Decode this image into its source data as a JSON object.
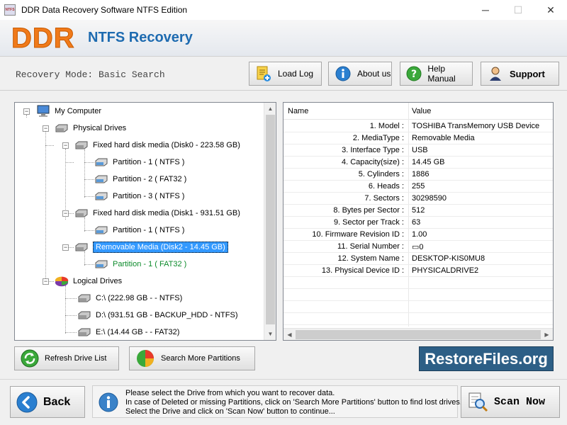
{
  "window": {
    "title": "DDR Data Recovery Software NTFS Edition",
    "minimize": "─",
    "maximize": "☐",
    "close": "✕"
  },
  "banner": {
    "logo": "DDR",
    "product": "NTFS Recovery"
  },
  "mode": {
    "label": "Recovery Mode: Basic Search"
  },
  "toolbar": {
    "load_log": "Load Log",
    "about_us": "About us",
    "help_manual": "Help Manual",
    "support": "Support"
  },
  "tree": {
    "my_computer": "My Computer",
    "physical_drives": "Physical Drives",
    "disk0": "Fixed hard disk media (Disk0 - 223.58 GB)",
    "disk0_p1": "Partition - 1 ( NTFS )",
    "disk0_p2": "Partition - 2 ( FAT32 )",
    "disk0_p3": "Partition - 3 ( NTFS )",
    "disk1": "Fixed hard disk media (Disk1 - 931.51 GB)",
    "disk1_p1": "Partition - 1 ( NTFS )",
    "disk2": "Removable Media (Disk2 - 14.45 GB)",
    "disk2_p1": "Partition - 1 ( FAT32 )",
    "logical_drives": "Logical Drives",
    "drive_c": "C:\\ (222.98 GB -  - NTFS)",
    "drive_d": "D:\\ (931.51 GB - BACKUP_HDD - NTFS)",
    "drive_e": "E:\\ (14.44 GB -  - FAT32)",
    "selected": "disk2"
  },
  "grid": {
    "col_name": "Name",
    "col_value": "Value",
    "rows": [
      {
        "name": "1. Model :",
        "value": "TOSHIBA TransMemory USB Device"
      },
      {
        "name": "2. MediaType :",
        "value": "Removable Media"
      },
      {
        "name": "3. Interface Type :",
        "value": "USB"
      },
      {
        "name": "4. Capacity(size) :",
        "value": "14.45 GB"
      },
      {
        "name": "5. Cylinders :",
        "value": "1886"
      },
      {
        "name": "6. Heads :",
        "value": "255"
      },
      {
        "name": "7. Sectors :",
        "value": "30298590"
      },
      {
        "name": "8. Bytes per Sector :",
        "value": "512"
      },
      {
        "name": "9. Sector per Track :",
        "value": "63"
      },
      {
        "name": "10. Firmware Revision ID :",
        "value": "1.00"
      },
      {
        "name": "11. Serial Number :",
        "value": "▭0"
      },
      {
        "name": "12. System Name :",
        "value": "DESKTOP-KIS0MU8"
      },
      {
        "name": "13. Physical Device ID :",
        "value": "PHYSICALDRIVE2"
      }
    ]
  },
  "actions": {
    "refresh": "Refresh Drive List",
    "search_more": "Search More Partitions",
    "restore_brand": "RestoreFiles.org"
  },
  "footer": {
    "back": "Back",
    "info_line1": "Please select the Drive from which you want to recover data.",
    "info_line2": "In case of Deleted or missing Partitions, click on 'Search More Partitions' button to find lost drives.",
    "info_line3": "Select the Drive and click on 'Scan Now' button to continue...",
    "scan_now": "Scan Now"
  },
  "colors": {
    "accent_orange": "#f07a1a",
    "accent_blue": "#1e6bb0",
    "selection": "#3399ff",
    "brand_bg": "#2d5f86"
  }
}
